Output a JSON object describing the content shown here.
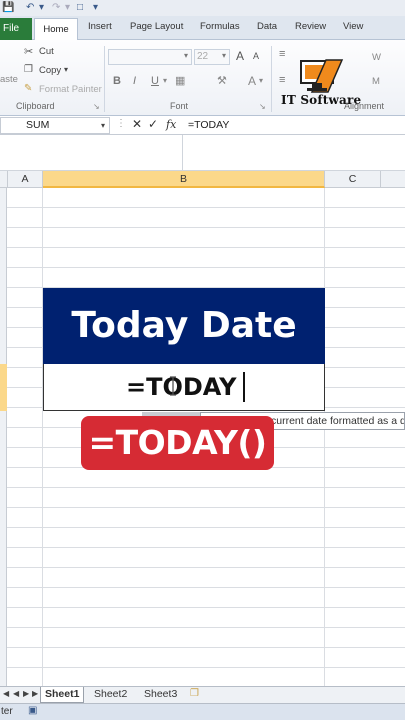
{
  "ribbon_tabs": {
    "file": "File",
    "home": "Home",
    "insert": "Insert",
    "page_layout": "Page Layout",
    "formulas": "Formulas",
    "data": "Data",
    "review": "Review",
    "view": "View"
  },
  "clipboard": {
    "cut": "Cut",
    "copy": "Copy",
    "format_painter": "Format Painter",
    "paste_partial": "aste",
    "group_label": "Clipboard"
  },
  "font_group": {
    "font_size": "22",
    "bold": "B",
    "italic": "I",
    "underline": "U",
    "grow": "A",
    "shrink": "A",
    "group_label": "Font"
  },
  "alignment_group": {
    "group_label": "Alignment",
    "wrap_partial": "W",
    "merge_partial": "M"
  },
  "logo": {
    "text": "IT Software"
  },
  "formula_bar": {
    "name_box": "SUM",
    "formula": "=TODAY"
  },
  "columns": [
    "A",
    "B",
    "C"
  ],
  "cells": {
    "title": "Today Date",
    "formula_entry": "=TODAY"
  },
  "tooltip": {
    "text": "current date formatted as a d"
  },
  "overlay_banner": "=TODAY()",
  "sheets": [
    "Sheet1",
    "Sheet2",
    "Sheet3"
  ],
  "status": {
    "mode_partial": "ter"
  },
  "colors": {
    "title_bg": "#002170",
    "banner_bg": "#d62b34",
    "file_tab": "#2a7c3a",
    "selected_header": "#fbd88a"
  }
}
